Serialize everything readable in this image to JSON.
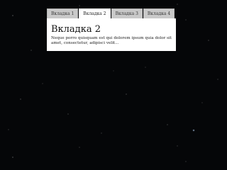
{
  "tabs": [
    {
      "label": "Вкладка 1",
      "active": false
    },
    {
      "label": "Вкладка 2",
      "active": true
    },
    {
      "label": "Вкладка 3",
      "active": false
    },
    {
      "label": "Вкладка 4",
      "active": false
    }
  ],
  "panel": {
    "title": "Вкладка 2",
    "text": "Neque porro quisquam est qui dolorem ipsum quia dolor sit amet, consectetur, adipisci velit..."
  },
  "colors": {
    "background": "#050608",
    "tab_inactive": "#c9c9c9",
    "tab_active": "#ffffff",
    "panel": "#ffffff"
  }
}
